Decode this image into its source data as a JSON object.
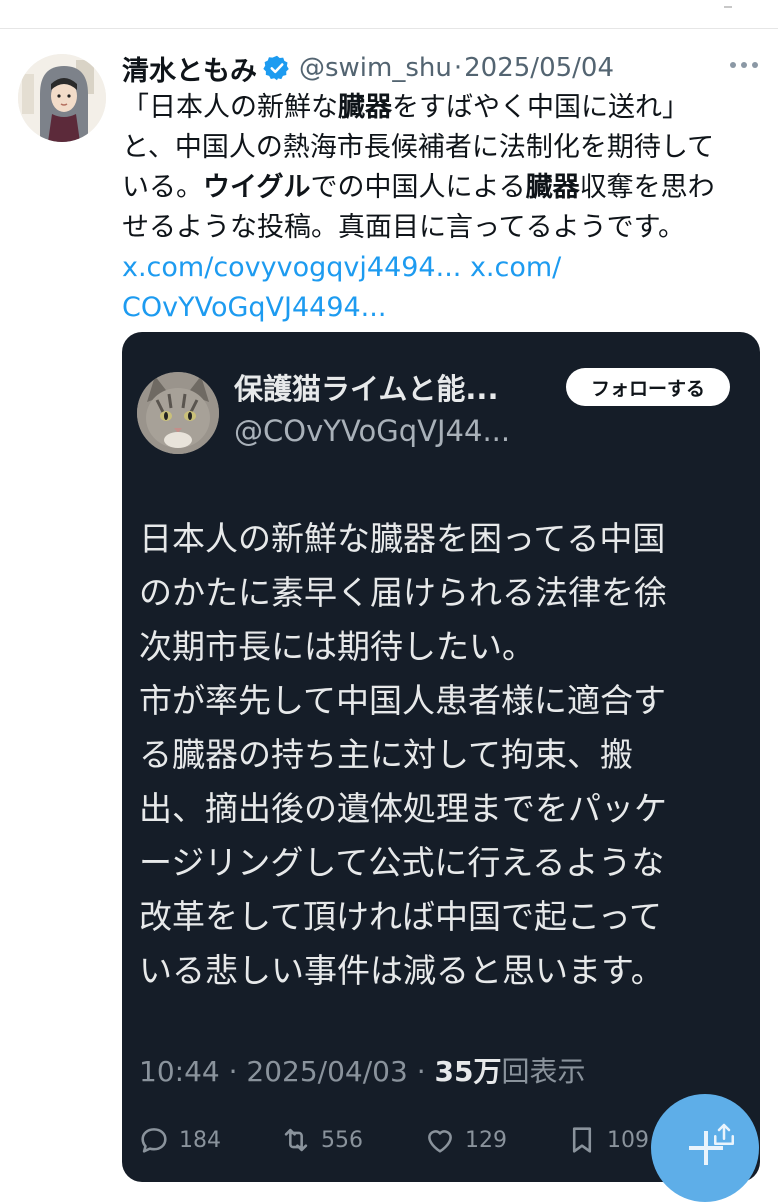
{
  "tweet": {
    "author_name": "清水ともみ",
    "handle": "@swim_shu",
    "separator": "·",
    "date": "2025/05/04",
    "text_line1": "「日本人の新鮮な",
    "text_line1_b": "臓器",
    "text_line1_c": "をすばやく中国に送れ」",
    "text_line2": "と、中国人の熱海市長候補者に法制化を期待して",
    "text_line3_a": "いる。",
    "text_line3_b": "ウイグル",
    "text_line3_c": "での中国人による",
    "text_line3_d": "臓器",
    "text_line3_e": "収奪を思わ",
    "text_line4": "せるような投稿。真面目に言ってるようです。",
    "link1": "x.com/covyvogqvj4494...",
    "link2": "x.com/",
    "link3": "COvYVoGqVJ4494..."
  },
  "quoted": {
    "name": "保護猫ライムと能...",
    "handle": "@COvYVoGqVJ44...",
    "follow_label": "フォローする",
    "lines": [
      "日本人の新鮮な臓器を困ってる中国",
      "のかたに素早く届けられる法律を徐",
      "次期市長には期待したい。",
      "市が率先して中国人患者様に適合す",
      "る臓器の持ち主に対して拘束、搬",
      "出、摘出後の遺体処理までをパッケ",
      "ージリングして公式に行えるような",
      "改革をして頂ければ中国で起こって",
      "いる悲しい事件は減ると思います。"
    ],
    "time": "10:44",
    "separator": "·",
    "date": "2025/04/03",
    "views_count": "35万",
    "views_label": "回表示",
    "replies": "184",
    "retweets": "556",
    "likes": "129",
    "bookmarks": "109"
  },
  "colors": {
    "link": "#1d9bf0",
    "card_bg": "#151d28",
    "verified": "#1d9bf0",
    "fab": "#5eaee8"
  },
  "icons": [
    "verified-badge-icon",
    "more-icon",
    "reply-icon",
    "retweet-icon",
    "like-icon",
    "bookmark-icon",
    "compose-plus-icon",
    "share-icon"
  ]
}
